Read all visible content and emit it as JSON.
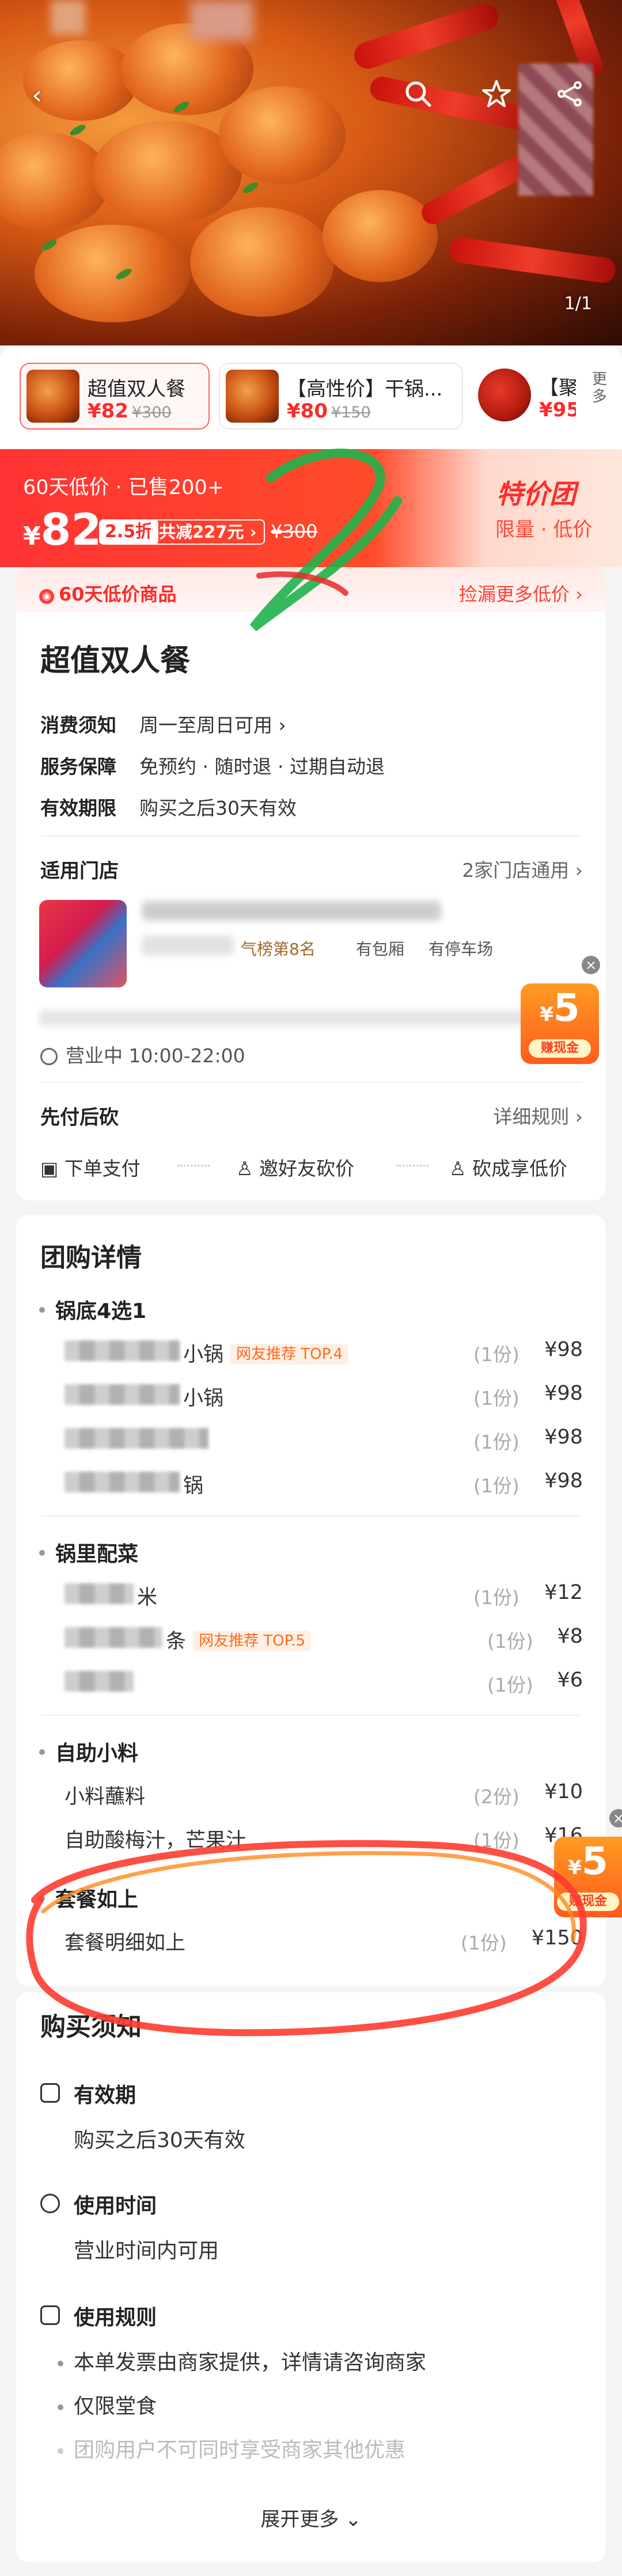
{
  "hero": {
    "counter": "1/1",
    "icons": [
      "back-icon",
      "search-icon",
      "star-icon",
      "share-icon"
    ]
  },
  "packages": [
    {
      "name": "超值双人餐",
      "price": "¥82",
      "old": "¥300"
    },
    {
      "name": "【高性价】干锅...",
      "price": "¥80",
      "old": "¥150"
    },
    {
      "name": "【聚",
      "price": "¥95",
      "old": ""
    }
  ],
  "packages_more": "更多",
  "promo": {
    "sold": "60天低价 · 已售200+",
    "currency": "¥",
    "price": "82",
    "discount": "2.5折",
    "saved": "共减227元 ›",
    "old_price": "¥300",
    "tag_title": "特价团",
    "tag_sub": "限量 · 低价"
  },
  "lowbar": {
    "left": "60天低价商品",
    "right": "捡漏更多低价 ›"
  },
  "deal": {
    "title": "超值双人餐",
    "rows": [
      {
        "label": "消费须知",
        "value": "周一至周日可用 ›"
      },
      {
        "label": "服务保障",
        "value": "免预约 · 随时退 · 过期自动退"
      },
      {
        "label": "有效期限",
        "value": "购买之后30天有效"
      }
    ]
  },
  "store": {
    "title": "适用门店",
    "right": "2家门店通用 ›",
    "tags": [
      "气榜第8名",
      "有包厢",
      "有停车场"
    ],
    "hours": "营业中 10:00-22:00"
  },
  "cash_badge": {
    "amount": "5",
    "currency": "¥",
    "label": "赚现金"
  },
  "pay": {
    "title": "先付后砍",
    "right": "详细规则 ›",
    "steps": [
      "下单支付",
      "邀好友砍价",
      "砍成享低价"
    ]
  },
  "details": {
    "title": "团购详情",
    "groups": [
      {
        "name": "锅底4选1",
        "items": [
          {
            "name": "小锅",
            "tag": "网友推荐 TOP.4",
            "qty": "(1份)",
            "price": "¥98"
          },
          {
            "name": "小锅",
            "tag": "",
            "qty": "(1份)",
            "price": "¥98"
          },
          {
            "name": "",
            "tag": "",
            "qty": "(1份)",
            "price": "¥98"
          },
          {
            "name": "锅",
            "tag": "",
            "qty": "(1份)",
            "price": "¥98"
          }
        ]
      },
      {
        "name": "锅里配菜",
        "items": [
          {
            "name": "米",
            "tag": "",
            "qty": "(1份)",
            "price": "¥12"
          },
          {
            "name": "条",
            "tag": "网友推荐 TOP.5",
            "qty": "(1份)",
            "price": "¥8"
          },
          {
            "name": "",
            "tag": "",
            "qty": "(1份)",
            "price": "¥6"
          }
        ]
      },
      {
        "name": "自助小料",
        "items": [
          {
            "name": "小料蘸料",
            "tag": "",
            "qty": "(2份)",
            "price": "¥10"
          },
          {
            "name": "自助酸梅汁，芒果汁",
            "tag": "",
            "qty": "(1份)",
            "price": "¥16"
          }
        ]
      },
      {
        "name": "套餐如上",
        "items": [
          {
            "name": "套餐明细如上",
            "tag": "",
            "qty": "(1份)",
            "price": "¥150"
          }
        ]
      }
    ]
  },
  "notes": {
    "title": "购买须知",
    "sections": [
      {
        "title": "有效期",
        "text": "购买之后30天有效"
      },
      {
        "title": "使用时间",
        "text": "营业时间内可用"
      },
      {
        "title": "使用规则",
        "items": [
          "本单发票由商家提供，详情请咨询商家",
          "仅限堂食",
          "团购用户不可同时享受商家其他优惠"
        ]
      }
    ],
    "expand": "展开更多 ⌄"
  }
}
